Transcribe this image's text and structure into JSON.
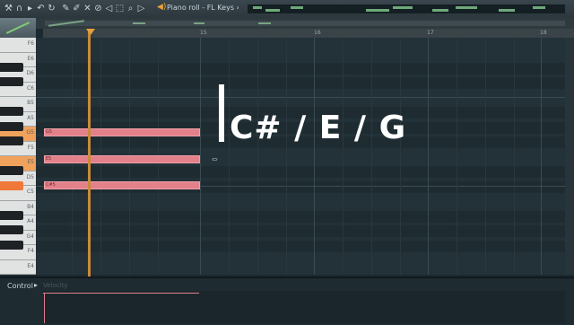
{
  "toolbar": {
    "icons": [
      "wrench-icon",
      "magnet-icon",
      "play-icon",
      "undo-icon",
      "pencil-icon",
      "brush-icon",
      "delete-icon",
      "mute-icon",
      "slice-icon",
      "select-icon",
      "zoom-icon",
      "speaker-icon"
    ],
    "title": "Piano roll - FL Keys",
    "title_arrow": "›"
  },
  "ruler": {
    "labels": [
      "15",
      "16",
      "17",
      "18"
    ]
  },
  "keyboard": {
    "labels": [
      "F6",
      "E6",
      "D6",
      "C6",
      "B5",
      "A5",
      "G5",
      "F5",
      "E5",
      "D5",
      "C5",
      "B4",
      "A4",
      "G4",
      "F4",
      "E4"
    ]
  },
  "notes": [
    {
      "label": "G5"
    },
    {
      "label": "E5"
    },
    {
      "label": "C#5"
    }
  ],
  "overlay": {
    "chord_text": "C# / E / G"
  },
  "control": {
    "label": "Control",
    "arrow": "▸",
    "velocity_label": "Velocity"
  },
  "colors": {
    "note": "#e2818a",
    "playhead": "#c98a3a",
    "key_highlight": "#f0a25d",
    "key_active": "#f07838",
    "accent": "#7fcb76"
  }
}
